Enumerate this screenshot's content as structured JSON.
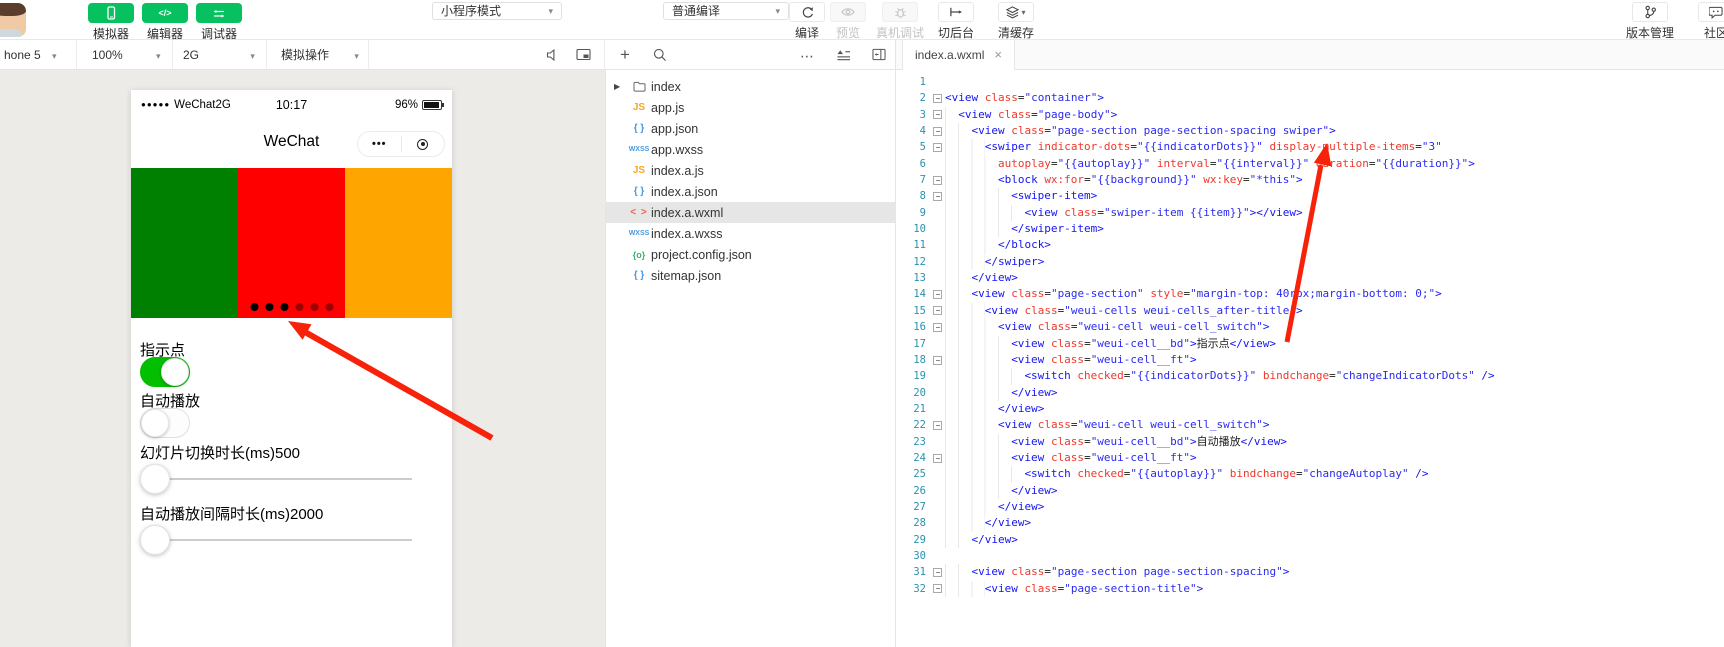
{
  "toolbar": {
    "nav_buttons": [
      {
        "label": "模拟器",
        "icon": "phone-icon"
      },
      {
        "label": "编辑器",
        "icon": "code-icon"
      },
      {
        "label": "调试器",
        "icon": "swap-arrows-icon"
      }
    ],
    "mode_dropdown": "小程序模式",
    "compile_dropdown": "普通编译",
    "actions": [
      {
        "label": "编译",
        "icon": "refresh-icon",
        "enabled": true
      },
      {
        "label": "预览",
        "icon": "eye-icon",
        "enabled": false
      },
      {
        "label": "真机调试",
        "icon": "bug-icon",
        "enabled": false
      },
      {
        "label": "切后台",
        "icon": "to-background-icon",
        "enabled": true
      },
      {
        "label": "清缓存",
        "icon": "layers-icon",
        "enabled": true,
        "has_caret": true
      }
    ],
    "right_actions": [
      {
        "label": "版本管理",
        "icon": "branch-icon"
      },
      {
        "label": "社区",
        "icon": "chat-icon"
      }
    ]
  },
  "sim_toolbar": {
    "device": "hone 5",
    "zoom": "100%",
    "network": "2G",
    "menu": "模拟操作"
  },
  "simulator": {
    "status_bar": {
      "signal_dots": "●●●●●",
      "carrier": "WeChat2G",
      "time": "10:17",
      "battery": "96%"
    },
    "nav_bar": {
      "title": "WeChat",
      "capsule_dots": "•••"
    },
    "swiper": {
      "item_colors": [
        "green",
        "red",
        "orange"
      ],
      "indicator_dots": {
        "total": 6,
        "active": 3
      }
    },
    "controls": [
      {
        "type": "switch",
        "label": "指示点",
        "on": true
      },
      {
        "type": "switch",
        "label": "自动播放",
        "on": false
      },
      {
        "type": "slider",
        "label": "幻灯片切换时长(ms)500"
      },
      {
        "type": "slider",
        "label": "自动播放间隔时长(ms)2000"
      }
    ]
  },
  "file_tree": {
    "items": [
      {
        "name": "index",
        "icon": "folder",
        "expandable": true,
        "selected": false
      },
      {
        "name": "app.js",
        "icon": "js",
        "selected": false
      },
      {
        "name": "app.json",
        "icon": "json",
        "selected": false
      },
      {
        "name": "app.wxss",
        "icon": "wxss",
        "selected": false
      },
      {
        "name": "index.a.js",
        "icon": "js",
        "selected": false
      },
      {
        "name": "index.a.json",
        "icon": "json",
        "selected": false
      },
      {
        "name": "index.a.wxml",
        "icon": "wxml",
        "selected": true
      },
      {
        "name": "index.a.wxss",
        "icon": "wxss",
        "selected": false
      },
      {
        "name": "project.config.json",
        "icon": "config",
        "selected": false
      },
      {
        "name": "sitemap.json",
        "icon": "json",
        "selected": false
      }
    ]
  },
  "editor": {
    "tab": {
      "name": "index.a.wxml",
      "close": "×"
    },
    "lines": [
      {
        "i": 0,
        "f": false,
        "t": []
      },
      {
        "i": 0,
        "f": true,
        "t": [
          [
            "t",
            "<view "
          ],
          [
            "a",
            "class"
          ],
          [
            "p",
            "="
          ],
          [
            "s",
            "\"container\""
          ],
          [
            "t",
            ">"
          ]
        ]
      },
      {
        "i": 1,
        "f": true,
        "t": [
          [
            "t",
            "<view "
          ],
          [
            "a",
            "class"
          ],
          [
            "p",
            "="
          ],
          [
            "s",
            "\"page-body\""
          ],
          [
            "t",
            ">"
          ]
        ]
      },
      {
        "i": 2,
        "f": true,
        "t": [
          [
            "t",
            "<view "
          ],
          [
            "a",
            "class"
          ],
          [
            "p",
            "="
          ],
          [
            "s",
            "\"page-section page-section-spacing swiper\""
          ],
          [
            "t",
            ">"
          ]
        ]
      },
      {
        "i": 3,
        "f": true,
        "t": [
          [
            "t",
            "<swiper "
          ],
          [
            "a",
            "indicator-dots"
          ],
          [
            "p",
            "="
          ],
          [
            "s",
            "\"{{indicatorDots}}\""
          ],
          [
            "p",
            " "
          ],
          [
            "a",
            "display-multiple-items"
          ],
          [
            "p",
            "="
          ],
          [
            "s",
            "\"3\""
          ]
        ]
      },
      {
        "i": 4,
        "f": false,
        "t": [
          [
            "a",
            "autoplay"
          ],
          [
            "p",
            "="
          ],
          [
            "s",
            "\"{{autoplay}}\""
          ],
          [
            "p",
            " "
          ],
          [
            "a",
            "interval"
          ],
          [
            "p",
            "="
          ],
          [
            "s",
            "\"{{interval}}\""
          ],
          [
            "p",
            " "
          ],
          [
            "a",
            "duration"
          ],
          [
            "p",
            "="
          ],
          [
            "s",
            "\"{{duration}}\""
          ],
          [
            "t",
            ">"
          ]
        ]
      },
      {
        "i": 4,
        "f": true,
        "t": [
          [
            "t",
            "<block "
          ],
          [
            "a",
            "wx:for"
          ],
          [
            "p",
            "="
          ],
          [
            "s",
            "\"{{background}}\""
          ],
          [
            "p",
            " "
          ],
          [
            "a",
            "wx:key"
          ],
          [
            "p",
            "="
          ],
          [
            "s",
            "\"*this\""
          ],
          [
            "t",
            ">"
          ]
        ]
      },
      {
        "i": 5,
        "f": true,
        "t": [
          [
            "t",
            "<swiper-item>"
          ]
        ]
      },
      {
        "i": 6,
        "f": false,
        "t": [
          [
            "t",
            "<view "
          ],
          [
            "a",
            "class"
          ],
          [
            "p",
            "="
          ],
          [
            "s",
            "\"swiper-item {{item}}\""
          ],
          [
            "t",
            "></view>"
          ]
        ]
      },
      {
        "i": 5,
        "f": false,
        "t": [
          [
            "t",
            "</swiper-item>"
          ]
        ]
      },
      {
        "i": 4,
        "f": false,
        "t": [
          [
            "t",
            "</block>"
          ]
        ]
      },
      {
        "i": 3,
        "f": false,
        "t": [
          [
            "t",
            "</swiper>"
          ]
        ]
      },
      {
        "i": 2,
        "f": false,
        "t": [
          [
            "t",
            "</view>"
          ]
        ]
      },
      {
        "i": 2,
        "f": true,
        "t": [
          [
            "t",
            "<view "
          ],
          [
            "a",
            "class"
          ],
          [
            "p",
            "="
          ],
          [
            "s",
            "\"page-section\""
          ],
          [
            "p",
            " "
          ],
          [
            "a",
            "style"
          ],
          [
            "p",
            "="
          ],
          [
            "s",
            "\"margin-top: 40rpx;margin-bottom: 0;\""
          ],
          [
            "t",
            ">"
          ]
        ]
      },
      {
        "i": 3,
        "f": true,
        "t": [
          [
            "t",
            "<view "
          ],
          [
            "a",
            "class"
          ],
          [
            "p",
            "="
          ],
          [
            "s",
            "\"weui-cells weui-cells_after-title\""
          ],
          [
            "t",
            ">"
          ]
        ]
      },
      {
        "i": 4,
        "f": true,
        "t": [
          [
            "t",
            "<view "
          ],
          [
            "a",
            "class"
          ],
          [
            "p",
            "="
          ],
          [
            "s",
            "\"weui-cell weui-cell_switch\""
          ],
          [
            "t",
            ">"
          ]
        ]
      },
      {
        "i": 5,
        "f": false,
        "t": [
          [
            "t",
            "<view "
          ],
          [
            "a",
            "class"
          ],
          [
            "p",
            "="
          ],
          [
            "s",
            "\"weui-cell__bd\""
          ],
          [
            "t",
            ">"
          ],
          [
            "p",
            "指示点"
          ],
          [
            "t",
            "</view>"
          ]
        ]
      },
      {
        "i": 5,
        "f": true,
        "t": [
          [
            "t",
            "<view "
          ],
          [
            "a",
            "class"
          ],
          [
            "p",
            "="
          ],
          [
            "s",
            "\"weui-cell__ft\""
          ],
          [
            "t",
            ">"
          ]
        ]
      },
      {
        "i": 6,
        "f": false,
        "t": [
          [
            "t",
            "<switch "
          ],
          [
            "a",
            "checked"
          ],
          [
            "p",
            "="
          ],
          [
            "s",
            "\"{{indicatorDots}}\""
          ],
          [
            "p",
            " "
          ],
          [
            "a",
            "bindchange"
          ],
          [
            "p",
            "="
          ],
          [
            "s",
            "\"changeIndicatorDots\""
          ],
          [
            "t",
            " />"
          ]
        ]
      },
      {
        "i": 5,
        "f": false,
        "t": [
          [
            "t",
            "</view>"
          ]
        ]
      },
      {
        "i": 4,
        "f": false,
        "t": [
          [
            "t",
            "</view>"
          ]
        ]
      },
      {
        "i": 4,
        "f": true,
        "t": [
          [
            "t",
            "<view "
          ],
          [
            "a",
            "class"
          ],
          [
            "p",
            "="
          ],
          [
            "s",
            "\"weui-cell weui-cell_switch\""
          ],
          [
            "t",
            ">"
          ]
        ]
      },
      {
        "i": 5,
        "f": false,
        "t": [
          [
            "t",
            "<view "
          ],
          [
            "a",
            "class"
          ],
          [
            "p",
            "="
          ],
          [
            "s",
            "\"weui-cell__bd\""
          ],
          [
            "t",
            ">"
          ],
          [
            "p",
            "自动播放"
          ],
          [
            "t",
            "</view>"
          ]
        ]
      },
      {
        "i": 5,
        "f": true,
        "t": [
          [
            "t",
            "<view "
          ],
          [
            "a",
            "class"
          ],
          [
            "p",
            "="
          ],
          [
            "s",
            "\"weui-cell__ft\""
          ],
          [
            "t",
            ">"
          ]
        ]
      },
      {
        "i": 6,
        "f": false,
        "t": [
          [
            "t",
            "<switch "
          ],
          [
            "a",
            "checked"
          ],
          [
            "p",
            "="
          ],
          [
            "s",
            "\"{{autoplay}}\""
          ],
          [
            "p",
            " "
          ],
          [
            "a",
            "bindchange"
          ],
          [
            "p",
            "="
          ],
          [
            "s",
            "\"changeAutoplay\""
          ],
          [
            "t",
            " />"
          ]
        ]
      },
      {
        "i": 5,
        "f": false,
        "t": [
          [
            "t",
            "</view>"
          ]
        ]
      },
      {
        "i": 4,
        "f": false,
        "t": [
          [
            "t",
            "</view>"
          ]
        ]
      },
      {
        "i": 3,
        "f": false,
        "t": [
          [
            "t",
            "</view>"
          ]
        ]
      },
      {
        "i": 2,
        "f": false,
        "t": [
          [
            "t",
            "</view>"
          ]
        ]
      },
      {
        "i": 0,
        "f": false,
        "t": []
      },
      {
        "i": 2,
        "f": true,
        "t": [
          [
            "t",
            "<view "
          ],
          [
            "a",
            "class"
          ],
          [
            "p",
            "="
          ],
          [
            "s",
            "\"page-section page-section-spacing\""
          ],
          [
            "t",
            ">"
          ]
        ]
      },
      {
        "i": 3,
        "f": true,
        "t": [
          [
            "t",
            "<view "
          ],
          [
            "a",
            "class"
          ],
          [
            "p",
            "="
          ],
          [
            "s",
            "\"page-section-title\""
          ],
          [
            "t",
            ">"
          ]
        ]
      }
    ]
  },
  "colors": {
    "accent_green": "#07c160",
    "switch_on_green": "#04be02",
    "arrow_red": "#f8220a",
    "swiper_items": [
      "green",
      "red",
      "orange"
    ],
    "code_tag_blue": "#1414f0",
    "code_attr_red": "#f0372b",
    "code_string_blue": "#2b2bf0",
    "line_number_teal": "#2b91af"
  }
}
